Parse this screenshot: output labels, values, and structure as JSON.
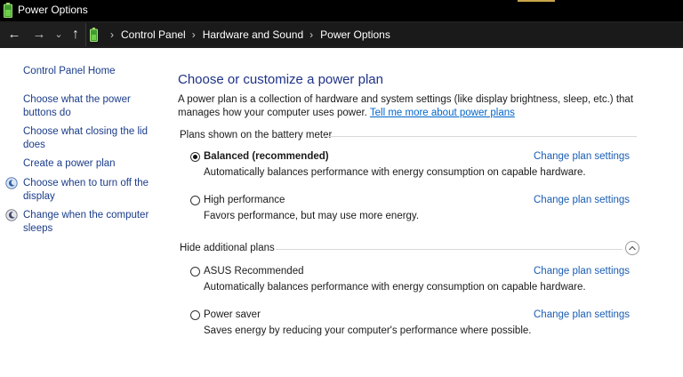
{
  "window": {
    "title": "Power Options"
  },
  "nav": {
    "back_glyph": "←",
    "forward_glyph": "→",
    "recent_glyph": "⌄",
    "up_glyph": "↑"
  },
  "breadcrumb": [
    "Control Panel",
    "Hardware and Sound",
    "Power Options"
  ],
  "sidebar": {
    "home": "Control Panel Home",
    "links": [
      "Choose what the power buttons do",
      "Choose what closing the lid does",
      "Create a power plan",
      "Choose when to turn off the display",
      "Change when the computer sleeps"
    ]
  },
  "main": {
    "heading": "Choose or customize a power plan",
    "description": "A power plan is a collection of hardware and system settings (like display brightness, sleep, etc.) that manages how your computer uses power.",
    "more_link": "Tell me more about power plans",
    "battery_section": "Plans shown on the battery meter",
    "hidden_section": "Hide additional plans",
    "change_label": "Change plan settings",
    "plans": [
      {
        "name": "Balanced (recommended)",
        "desc": "Automatically balances performance with energy consumption on capable hardware.",
        "selected": true
      },
      {
        "name": "High performance",
        "desc": "Favors performance, but may use more energy.",
        "selected": false
      },
      {
        "name": "ASUS Recommended",
        "desc": "Automatically balances performance with energy consumption on capable hardware.",
        "selected": false
      },
      {
        "name": "Power saver",
        "desc": "Saves energy by reducing your computer's performance where possible.",
        "selected": false
      }
    ]
  },
  "colors": {
    "titlebar": "#000000",
    "link": "#1a3c8a",
    "heading": "#1e3287",
    "accent_link": "#0066cc"
  },
  "icons": {
    "app": "battery-icon",
    "display": "monitor-moon-icon",
    "sleep": "moon-icon"
  }
}
